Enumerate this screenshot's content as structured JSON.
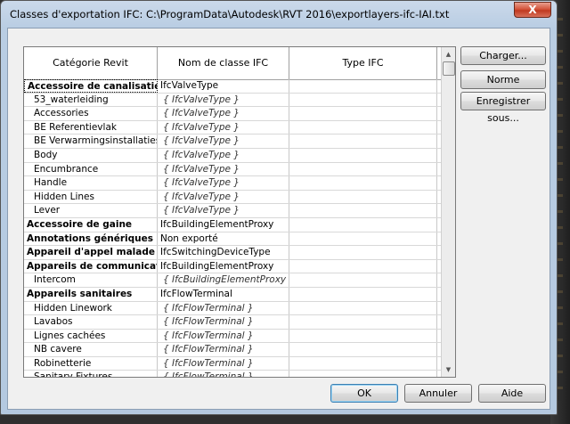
{
  "window": {
    "title": "Classes d'exportation IFC: C:\\ProgramData\\Autodesk\\RVT 2016\\exportlayers-ifc-IAI.txt",
    "close_label": "X"
  },
  "grid": {
    "headers": [
      "Catégorie Revit",
      "Nom de classe IFC",
      "Type IFC"
    ],
    "rows": [
      {
        "kind": "parent",
        "category": "Accessoire de canalisation",
        "ifc_class": "IfcValveType",
        "ifc_type": ""
      },
      {
        "kind": "child",
        "category": "53_waterleiding",
        "ifc_class": "{ IfcValveType }",
        "ifc_type": ""
      },
      {
        "kind": "child",
        "category": "Accessories",
        "ifc_class": "{ IfcValveType }",
        "ifc_type": ""
      },
      {
        "kind": "child",
        "category": "BE Referentievlak",
        "ifc_class": "{ IfcValveType }",
        "ifc_type": ""
      },
      {
        "kind": "child",
        "category": "BE Verwarmingsinstallaties, to",
        "ifc_class": "{ IfcValveType }",
        "ifc_type": ""
      },
      {
        "kind": "child",
        "category": "Body",
        "ifc_class": "{ IfcValveType }",
        "ifc_type": ""
      },
      {
        "kind": "child",
        "category": "Encumbrance",
        "ifc_class": "{ IfcValveType }",
        "ifc_type": ""
      },
      {
        "kind": "child",
        "category": "Handle",
        "ifc_class": "{ IfcValveType }",
        "ifc_type": ""
      },
      {
        "kind": "child",
        "category": "Hidden Lines",
        "ifc_class": "{ IfcValveType }",
        "ifc_type": ""
      },
      {
        "kind": "child",
        "category": "Lever",
        "ifc_class": "{ IfcValveType }",
        "ifc_type": ""
      },
      {
        "kind": "parent",
        "category": "Accessoire de gaine",
        "ifc_class": "IfcBuildingElementProxy",
        "ifc_type": ""
      },
      {
        "kind": "parent",
        "category": "Annotations génériques",
        "ifc_class": "Non exporté",
        "ifc_type": ""
      },
      {
        "kind": "parent",
        "category": "Appareil d'appel malade",
        "ifc_class": "IfcSwitchingDeviceType",
        "ifc_type": ""
      },
      {
        "kind": "parent",
        "category": "Appareils de communication",
        "ifc_class": "IfcBuildingElementProxy",
        "ifc_type": ""
      },
      {
        "kind": "child",
        "category": "Intercom",
        "ifc_class": "{ IfcBuildingElementProxy }",
        "ifc_type": ""
      },
      {
        "kind": "parent",
        "category": "Appareils sanitaires",
        "ifc_class": "IfcFlowTerminal",
        "ifc_type": ""
      },
      {
        "kind": "child",
        "category": "Hidden Linework",
        "ifc_class": "{ IfcFlowTerminal }",
        "ifc_type": ""
      },
      {
        "kind": "child",
        "category": "Lavabos",
        "ifc_class": "{ IfcFlowTerminal }",
        "ifc_type": ""
      },
      {
        "kind": "child",
        "category": "Lignes cachées",
        "ifc_class": "{ IfcFlowTerminal }",
        "ifc_type": ""
      },
      {
        "kind": "child",
        "category": "NB cavere",
        "ifc_class": "{ IfcFlowTerminal }",
        "ifc_type": ""
      },
      {
        "kind": "child",
        "category": "Robinetterie",
        "ifc_class": "{ IfcFlowTerminal }",
        "ifc_type": ""
      },
      {
        "kind": "child",
        "category": "Sanitary Fixtures",
        "ifc_class": "{ IfcFlowTerminal }",
        "ifc_type": ""
      }
    ]
  },
  "side_buttons": {
    "load": "Charger...",
    "standard": "Norme",
    "save_as": "Enregistrer sous..."
  },
  "footer_buttons": {
    "ok": "OK",
    "cancel": "Annuler",
    "help": "Aide"
  },
  "icons": {
    "scroll_up": "▲",
    "scroll_down": "▼"
  }
}
